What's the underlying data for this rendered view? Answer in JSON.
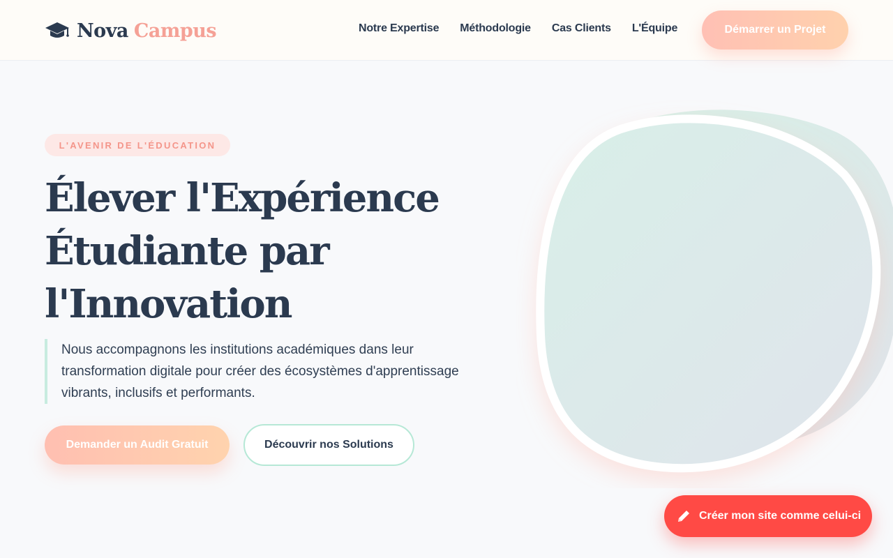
{
  "brand": {
    "name_primary": "Nova",
    "name_accent": "Campus",
    "logo_icon": "graduation-cap-icon"
  },
  "nav": {
    "items": [
      {
        "label": "Notre Expertise"
      },
      {
        "label": "Méthodologie"
      },
      {
        "label": "Cas Clients"
      },
      {
        "label": "L'Équipe"
      }
    ],
    "cta_label": "Démarrer un Projet"
  },
  "hero": {
    "badge": "L'AVENIR DE L'ÉDUCATION",
    "title_lines": [
      "Élever l'Expérience",
      "Étudiante par",
      "l'Innovation"
    ],
    "lead": "Nous accompagnons les institutions académiques dans leur transformation digitale pour créer des écosystèmes d'apprentissage vibrants, inclusifs et performants.",
    "primary_button": "Demander un Audit Gratuit",
    "secondary_button": "Découvrir nos Solutions"
  },
  "floating_cta": {
    "label": "Créer mon site comme celui-ci",
    "icon": "pencil-icon"
  },
  "colors": {
    "navy": "#2b3a4f",
    "peach": "#f5a196",
    "mint": "#b6e8d6",
    "coral": "#ff4a45"
  }
}
